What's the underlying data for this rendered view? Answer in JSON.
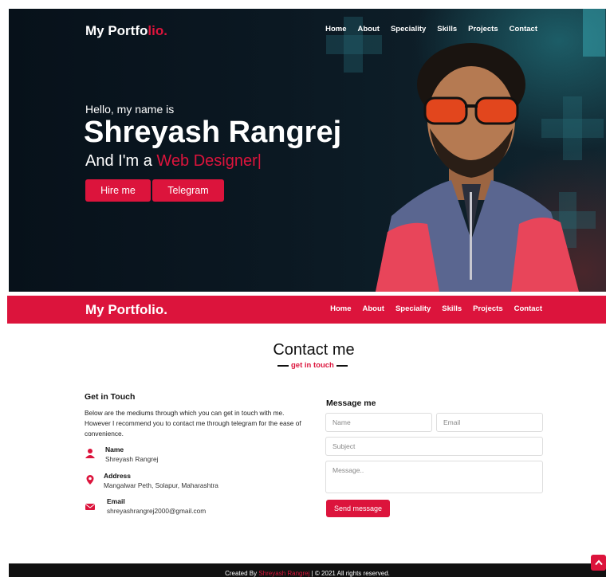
{
  "hero": {
    "brand_main": "My Portfo",
    "brand_accent": "lio.",
    "nav": [
      "Home",
      "About",
      "Speciality",
      "Skills",
      "Projects",
      "Contact"
    ],
    "hello": "Hello, my name is",
    "name": "Shreyash Rangrej",
    "role_prefix": "And I'm a ",
    "role_typed": "Web Designer|",
    "buttons": [
      "Hire me",
      "Telegram"
    ]
  },
  "navbar": {
    "brand": "My Portfolio.",
    "nav": [
      "Home",
      "About",
      "Speciality",
      "Skills",
      "Projects",
      "Contact"
    ]
  },
  "contact": {
    "title": "Contact me",
    "subtitle": "get in touch",
    "get_in_touch_title": "Get in Touch",
    "description": "Below are the mediums through which you can get in touch with me. However I recommend you to contact me through telegram for the ease of convenience.",
    "items": [
      {
        "label": "Name",
        "value": "Shreyash Rangrej",
        "icon": "user-icon"
      },
      {
        "label": "Address",
        "value": "Mangalwar Peth, Solapur, Maharashtra",
        "icon": "map-marker-icon"
      },
      {
        "label": "Email",
        "value": "shreyashrangrej2000@gmail.com",
        "icon": "envelope-icon"
      }
    ],
    "form": {
      "title": "Message me",
      "name_placeholder": "Name",
      "email_placeholder": "Email",
      "subject_placeholder": "Subject",
      "message_placeholder": "Message..",
      "send_label": "Send message"
    }
  },
  "footer": {
    "prefix": "Created By ",
    "name": "Shreyash Rangrej",
    "suffix": " | © 2021 All rights reserved."
  },
  "colors": {
    "accent": "#dc143c",
    "hero_bg": "#0b1620",
    "footer_bg": "#111111"
  }
}
